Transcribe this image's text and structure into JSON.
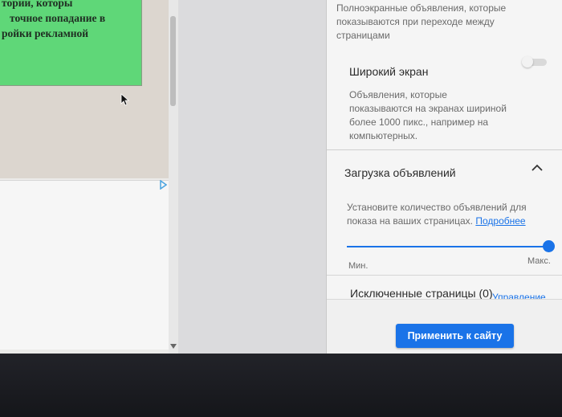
{
  "preview": {
    "ad_text_lines": [
      "тории, которы",
      "точное попадание в",
      "ройки рекламной"
    ]
  },
  "panel": {
    "fullscreen_desc": "Полноэкранные объявления, которые показываются при переходе между страницами",
    "wide_screen": {
      "title": "Широкий экран",
      "desc": "Объявления, которые показываются на экранах шириной более 1000 пикс., например на компьютерных.",
      "enabled": false
    },
    "ad_load": {
      "title": "Загрузка объявлений",
      "desc": "Установите количество объявлений для показа на ваших страницах.",
      "more_link": "Подробнее",
      "min_label": "Мин.",
      "max_label": "Макс.",
      "value": 1.0
    },
    "excluded_pages": {
      "title": "Исключенные страницы (0)",
      "manage_link": "Управление"
    },
    "apply_button": "Применить к сайту"
  },
  "colors": {
    "accent": "#1a73e8",
    "ad_green": "#5fd778"
  },
  "icons": [
    "cursor-icon",
    "adchoices-icon",
    "chevron-up-icon",
    "scroll-down-arrow-icon"
  ]
}
